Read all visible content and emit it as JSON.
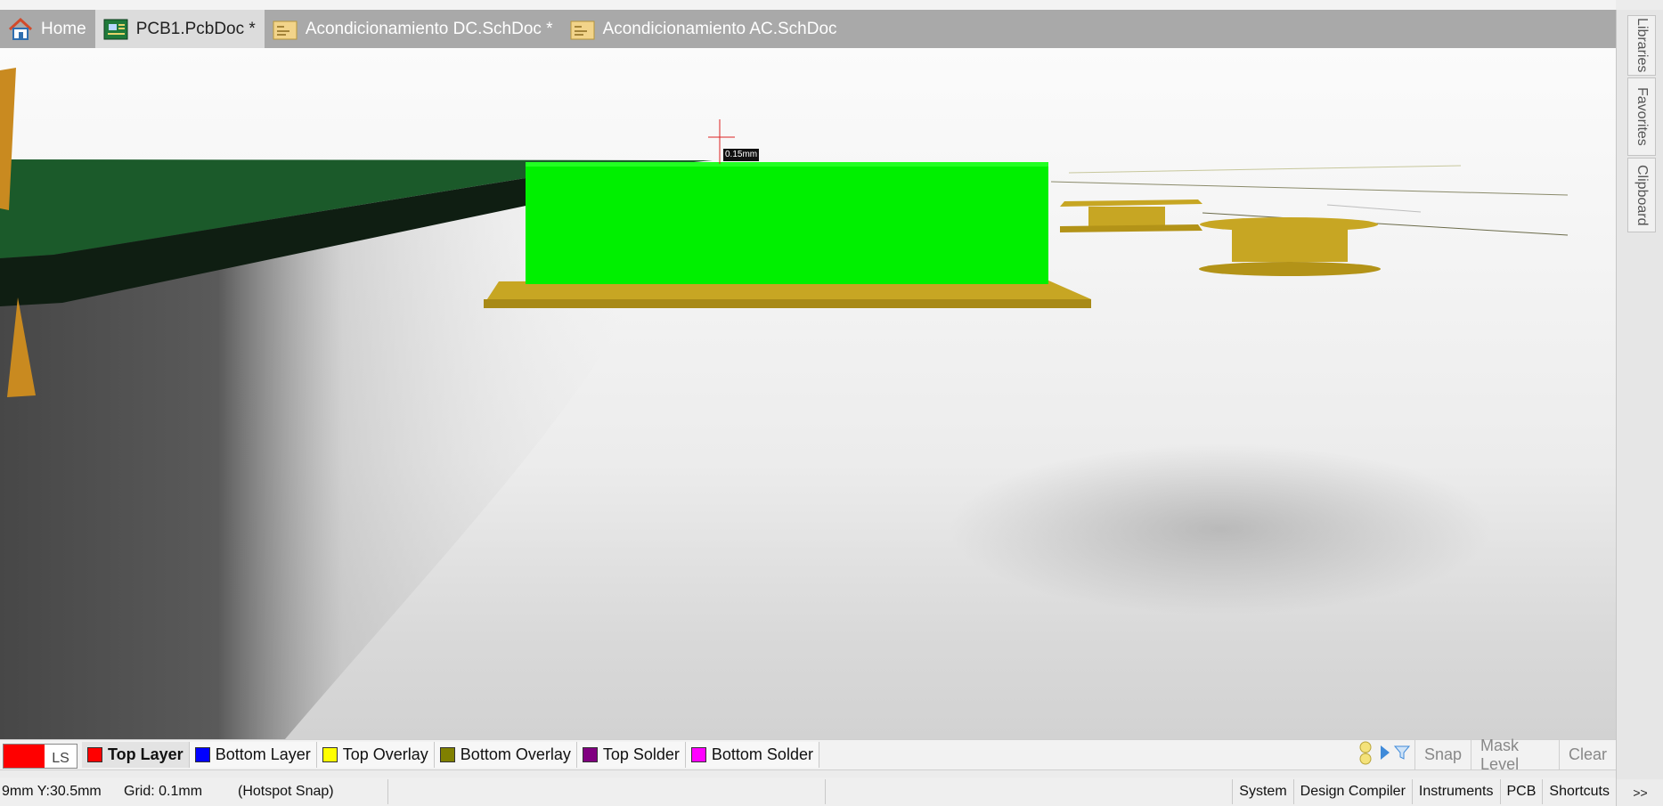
{
  "tabs": [
    {
      "label": "Home",
      "icon": "home-icon",
      "active": false
    },
    {
      "label": "PCB1.PcbDoc *",
      "icon": "pcb-document-icon",
      "active": true
    },
    {
      "label": "Acondicionamiento DC.SchDoc *",
      "icon": "schematic-document-icon",
      "active": false
    },
    {
      "label": "Acondicionamiento AC.SchDoc",
      "icon": "schematic-document-icon",
      "active": false
    }
  ],
  "viewport": {
    "dimension_label": "0.15mm",
    "colors": {
      "board": "#1b5a2a",
      "board_edge": "#0f1e12",
      "component_body": "#00f000",
      "pad": "#c7a623",
      "floor_dark": "#4b4b4b"
    }
  },
  "right_panels": [
    "Libraries",
    "Favorites",
    "Clipboard"
  ],
  "layer_bar": {
    "ls_label": "LS",
    "current_color": "#ff0000",
    "layers": [
      {
        "name": "Top Layer",
        "color": "#ff0000",
        "active": true
      },
      {
        "name": "Bottom Layer",
        "color": "#0000ff",
        "active": false
      },
      {
        "name": "Top Overlay",
        "color": "#ffff00",
        "active": false
      },
      {
        "name": "Bottom Overlay",
        "color": "#808000",
        "active": false
      },
      {
        "name": "Top Solder",
        "color": "#800080",
        "active": false
      },
      {
        "name": "Bottom Solder",
        "color": "#ff00ff",
        "active": false
      }
    ],
    "snap_label": "Snap",
    "mask_level_label": "Mask Level",
    "clear_label": "Clear"
  },
  "status": {
    "coords": "9mm Y:30.5mm",
    "grid": "Grid: 0.1mm",
    "snap": "(Hotspot Snap)",
    "panels": [
      "System",
      "Design Compiler",
      "Instruments",
      "PCB",
      "Shortcuts"
    ],
    "more": ">>"
  }
}
